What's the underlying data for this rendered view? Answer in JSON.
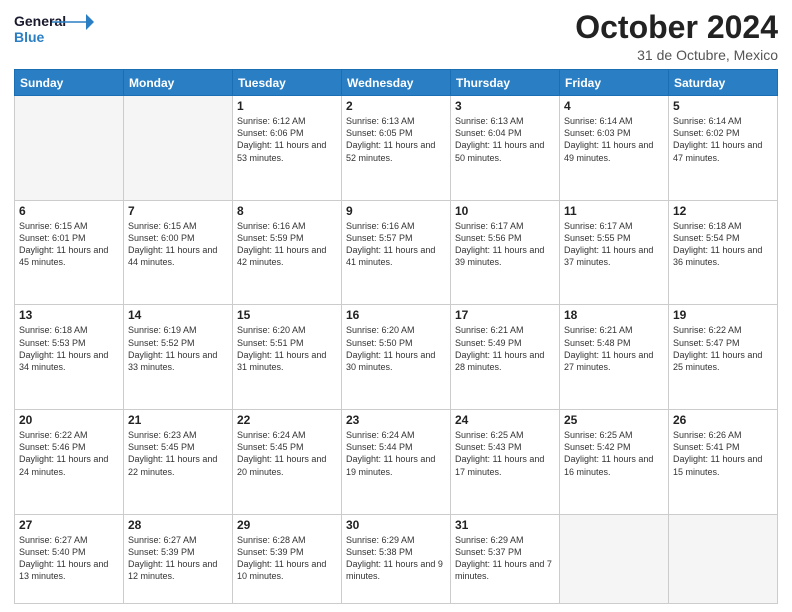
{
  "logo": {
    "general": "General",
    "blue": "Blue",
    "icon_color": "#2a7fc4"
  },
  "header": {
    "title": "October 2024",
    "subtitle": "31 de Octubre, Mexico"
  },
  "days_of_week": [
    "Sunday",
    "Monday",
    "Tuesday",
    "Wednesday",
    "Thursday",
    "Friday",
    "Saturday"
  ],
  "weeks": [
    [
      {
        "day": "",
        "empty": true
      },
      {
        "day": "",
        "empty": true
      },
      {
        "day": "1",
        "sunrise": "6:12 AM",
        "sunset": "6:06 PM",
        "daylight": "11 hours and 53 minutes."
      },
      {
        "day": "2",
        "sunrise": "6:13 AM",
        "sunset": "6:05 PM",
        "daylight": "11 hours and 52 minutes."
      },
      {
        "day": "3",
        "sunrise": "6:13 AM",
        "sunset": "6:04 PM",
        "daylight": "11 hours and 50 minutes."
      },
      {
        "day": "4",
        "sunrise": "6:14 AM",
        "sunset": "6:03 PM",
        "daylight": "11 hours and 49 minutes."
      },
      {
        "day": "5",
        "sunrise": "6:14 AM",
        "sunset": "6:02 PM",
        "daylight": "11 hours and 47 minutes."
      }
    ],
    [
      {
        "day": "6",
        "sunrise": "6:15 AM",
        "sunset": "6:01 PM",
        "daylight": "11 hours and 45 minutes."
      },
      {
        "day": "7",
        "sunrise": "6:15 AM",
        "sunset": "6:00 PM",
        "daylight": "11 hours and 44 minutes."
      },
      {
        "day": "8",
        "sunrise": "6:16 AM",
        "sunset": "5:59 PM",
        "daylight": "11 hours and 42 minutes."
      },
      {
        "day": "9",
        "sunrise": "6:16 AM",
        "sunset": "5:57 PM",
        "daylight": "11 hours and 41 minutes."
      },
      {
        "day": "10",
        "sunrise": "6:17 AM",
        "sunset": "5:56 PM",
        "daylight": "11 hours and 39 minutes."
      },
      {
        "day": "11",
        "sunrise": "6:17 AM",
        "sunset": "5:55 PM",
        "daylight": "11 hours and 37 minutes."
      },
      {
        "day": "12",
        "sunrise": "6:18 AM",
        "sunset": "5:54 PM",
        "daylight": "11 hours and 36 minutes."
      }
    ],
    [
      {
        "day": "13",
        "sunrise": "6:18 AM",
        "sunset": "5:53 PM",
        "daylight": "11 hours and 34 minutes."
      },
      {
        "day": "14",
        "sunrise": "6:19 AM",
        "sunset": "5:52 PM",
        "daylight": "11 hours and 33 minutes."
      },
      {
        "day": "15",
        "sunrise": "6:20 AM",
        "sunset": "5:51 PM",
        "daylight": "11 hours and 31 minutes."
      },
      {
        "day": "16",
        "sunrise": "6:20 AM",
        "sunset": "5:50 PM",
        "daylight": "11 hours and 30 minutes."
      },
      {
        "day": "17",
        "sunrise": "6:21 AM",
        "sunset": "5:49 PM",
        "daylight": "11 hours and 28 minutes."
      },
      {
        "day": "18",
        "sunrise": "6:21 AM",
        "sunset": "5:48 PM",
        "daylight": "11 hours and 27 minutes."
      },
      {
        "day": "19",
        "sunrise": "6:22 AM",
        "sunset": "5:47 PM",
        "daylight": "11 hours and 25 minutes."
      }
    ],
    [
      {
        "day": "20",
        "sunrise": "6:22 AM",
        "sunset": "5:46 PM",
        "daylight": "11 hours and 24 minutes."
      },
      {
        "day": "21",
        "sunrise": "6:23 AM",
        "sunset": "5:45 PM",
        "daylight": "11 hours and 22 minutes."
      },
      {
        "day": "22",
        "sunrise": "6:24 AM",
        "sunset": "5:45 PM",
        "daylight": "11 hours and 20 minutes."
      },
      {
        "day": "23",
        "sunrise": "6:24 AM",
        "sunset": "5:44 PM",
        "daylight": "11 hours and 19 minutes."
      },
      {
        "day": "24",
        "sunrise": "6:25 AM",
        "sunset": "5:43 PM",
        "daylight": "11 hours and 17 minutes."
      },
      {
        "day": "25",
        "sunrise": "6:25 AM",
        "sunset": "5:42 PM",
        "daylight": "11 hours and 16 minutes."
      },
      {
        "day": "26",
        "sunrise": "6:26 AM",
        "sunset": "5:41 PM",
        "daylight": "11 hours and 15 minutes."
      }
    ],
    [
      {
        "day": "27",
        "sunrise": "6:27 AM",
        "sunset": "5:40 PM",
        "daylight": "11 hours and 13 minutes."
      },
      {
        "day": "28",
        "sunrise": "6:27 AM",
        "sunset": "5:39 PM",
        "daylight": "11 hours and 12 minutes."
      },
      {
        "day": "29",
        "sunrise": "6:28 AM",
        "sunset": "5:39 PM",
        "daylight": "11 hours and 10 minutes."
      },
      {
        "day": "30",
        "sunrise": "6:29 AM",
        "sunset": "5:38 PM",
        "daylight": "11 hours and 9 minutes."
      },
      {
        "day": "31",
        "sunrise": "6:29 AM",
        "sunset": "5:37 PM",
        "daylight": "11 hours and 7 minutes."
      },
      {
        "day": "",
        "empty": true
      },
      {
        "day": "",
        "empty": true
      }
    ]
  ]
}
